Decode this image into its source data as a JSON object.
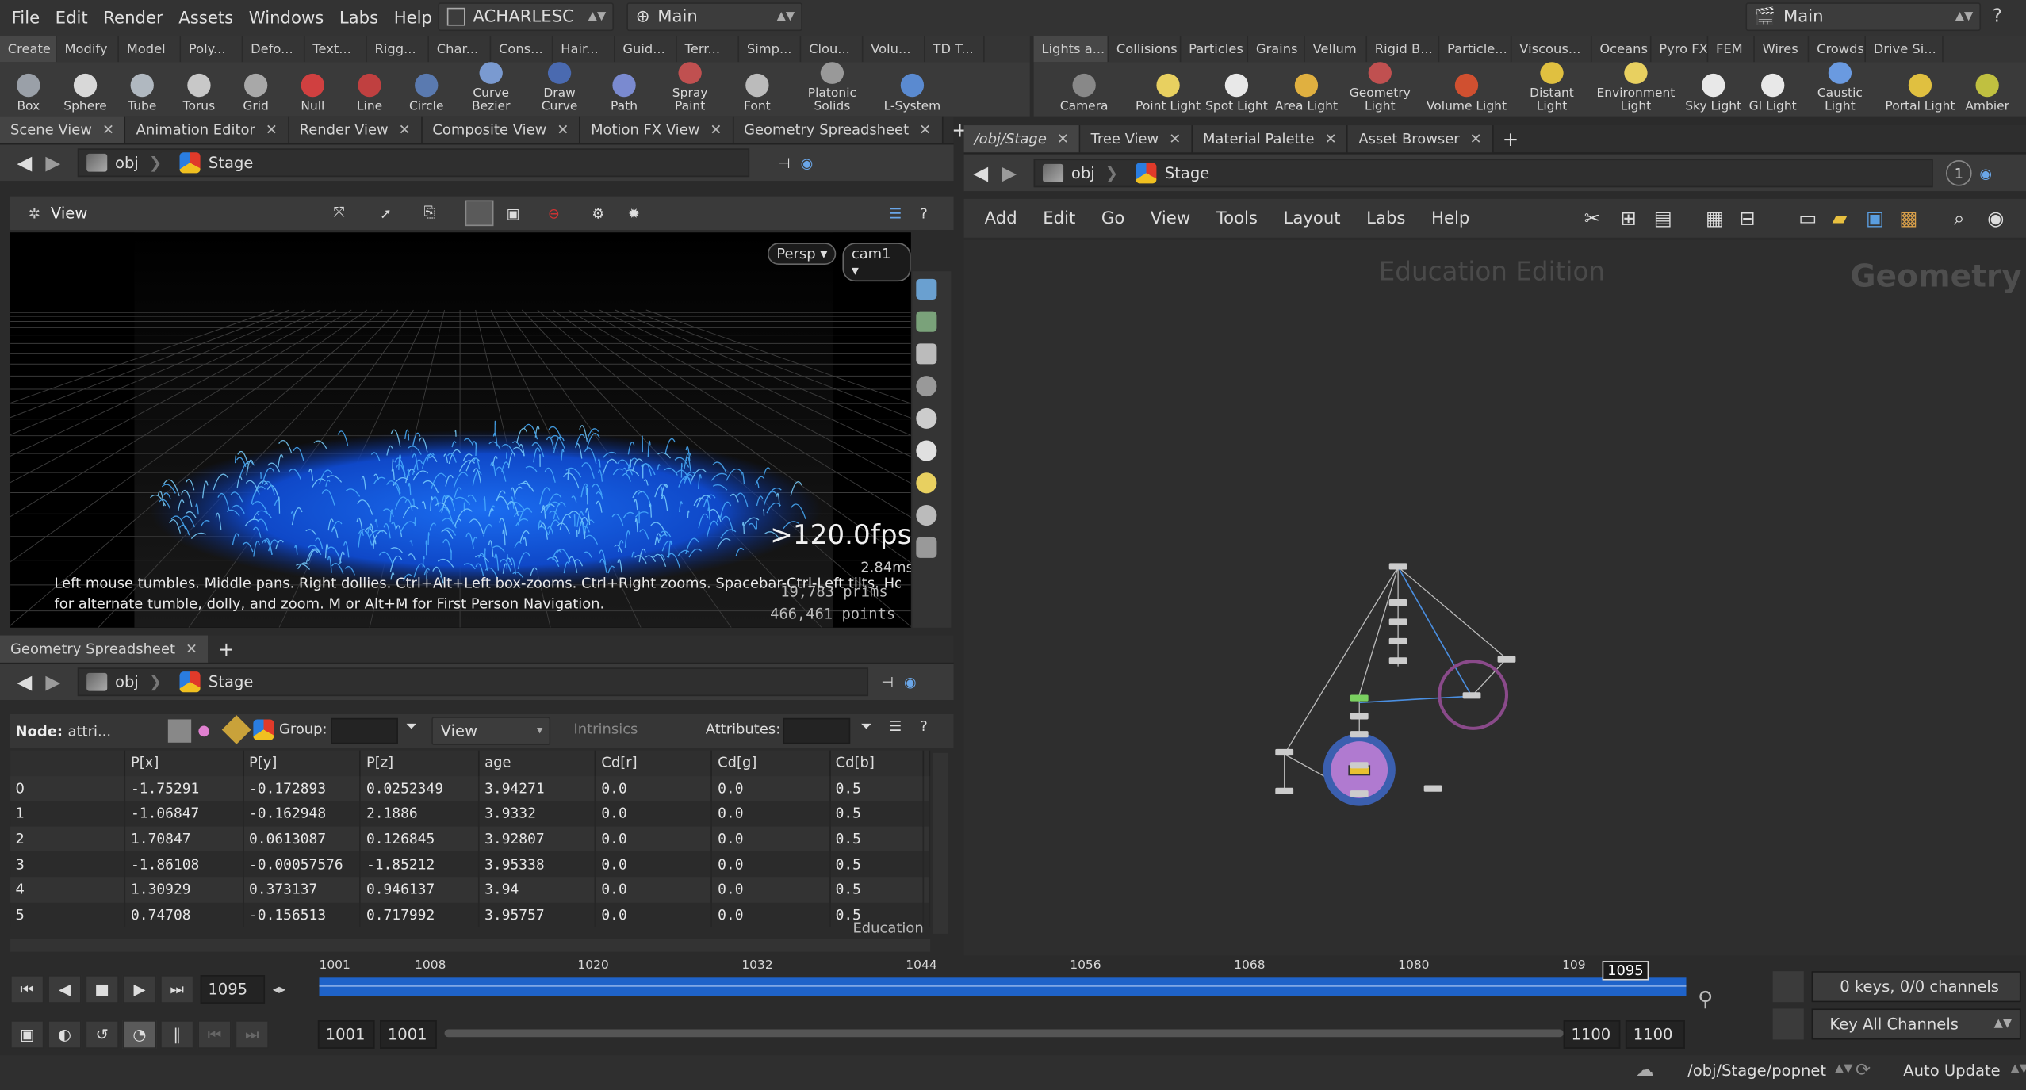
{
  "menu": {
    "items": [
      "File",
      "Edit",
      "Render",
      "Assets",
      "Windows",
      "Labs",
      "Help"
    ],
    "desktop": "ACHARLESC",
    "context": "Main",
    "right_desktop": "Main"
  },
  "shelf_left": {
    "tabs": [
      "Create",
      "Modify",
      "Model",
      "Poly...",
      "Defo...",
      "Text...",
      "Rigg...",
      "Char...",
      "Cons...",
      "Hair...",
      "Guid...",
      "Terr...",
      "Simp...",
      "Clou...",
      "Volu...",
      "TD T..."
    ],
    "tools": [
      "Box",
      "Sphere",
      "Tube",
      "Torus",
      "Grid",
      "Null",
      "Line",
      "Circle",
      "Curve Bezier",
      "Draw Curve",
      "Path",
      "Spray Paint",
      "Font",
      "Platonic Solids",
      "L-System"
    ]
  },
  "shelf_right": {
    "tabs": [
      "Lights a...",
      "Collisions",
      "Particles",
      "Grains",
      "Vellum",
      "Rigid B...",
      "Particle...",
      "Viscous...",
      "Oceans",
      "Pyro FX",
      "FEM",
      "Wires",
      "Crowds",
      "Drive Si..."
    ],
    "tools": [
      "Camera",
      "Point Light",
      "Spot Light",
      "Area Light",
      "Geometry Light",
      "Volume Light",
      "Distant Light",
      "Environment Light",
      "Sky Light",
      "GI Light",
      "Caustic Light",
      "Portal Light",
      "Ambier"
    ]
  },
  "left_pane": {
    "tabs": [
      "Scene View",
      "Animation Editor",
      "Render View",
      "Composite View",
      "Motion FX View",
      "Geometry Spreadsheet"
    ],
    "path": {
      "root": "obj",
      "node": "Stage"
    },
    "view_label": "View",
    "persp": "Persp",
    "camera": "cam1",
    "fps": ">120.0fps",
    "ms": "2.84ms",
    "prims": "19,783  prims",
    "points": "466,461 points",
    "hint_line1": "Left mouse tumbles. Middle pans. Right dollies. Ctrl+Alt+Left box-zooms. Ctrl+Right zooms. Spacebar-Ctrl-Left tilts. Hold L",
    "hint_line2": "for alternate tumble, dolly, and zoom.    M or Alt+M for First Person Navigation."
  },
  "spreadsheet": {
    "tab": "Geometry Spreadsheet",
    "path": {
      "root": "obj",
      "node": "Stage"
    },
    "node_label": "Node:",
    "node_value": "attri...",
    "group_label": "Group:",
    "view_label": "View",
    "intrinsics_label": "Intrinsics",
    "attributes_label": "Attributes:",
    "columns": [
      "P[x]",
      "P[y]",
      "P[z]",
      "age",
      "Cd[r]",
      "Cd[g]",
      "Cd[b]"
    ],
    "rows": [
      {
        "i": "0",
        "c": [
          "-1.75291",
          "-0.172893",
          "0.0252349",
          "3.94271",
          "0.0",
          "0.0",
          "0.5"
        ]
      },
      {
        "i": "1",
        "c": [
          "-1.06847",
          "-0.162948",
          "2.1886",
          "3.9332",
          "0.0",
          "0.0",
          "0.5"
        ]
      },
      {
        "i": "2",
        "c": [
          "1.70847",
          "0.0613087",
          "0.126845",
          "3.92807",
          "0.0",
          "0.0",
          "0.5"
        ]
      },
      {
        "i": "3",
        "c": [
          "-1.86108",
          "-0.00057576",
          "-1.85212",
          "3.95338",
          "0.0",
          "0.0",
          "0.5"
        ]
      },
      {
        "i": "4",
        "c": [
          "1.30929",
          "0.373137",
          "0.946137",
          "3.94",
          "0.0",
          "0.0",
          "0.5"
        ]
      },
      {
        "i": "5",
        "c": [
          "0.74708",
          "-0.156513",
          "0.717992",
          "3.95757",
          "0.0",
          "0.0",
          "0.5"
        ]
      }
    ],
    "watermark": "Education"
  },
  "right_pane": {
    "tabs": [
      "/obj/Stage",
      "Tree View",
      "Material Palette",
      "Asset Browser"
    ],
    "path": {
      "root": "obj",
      "node": "Stage"
    },
    "counter": "1",
    "menu": [
      "Add",
      "Edit",
      "Go",
      "View",
      "Tools",
      "Layout",
      "Labs",
      "Help"
    ],
    "edition": "Education Edition",
    "context_label": "Geometry"
  },
  "timeline": {
    "current_frame": "1095",
    "ticks": [
      "1001",
      "1008",
      "1020",
      "1032",
      "1044",
      "1056",
      "1068",
      "1080",
      "109"
    ],
    "marker": "1095",
    "start": "1001",
    "start2": "1001",
    "end": "1100",
    "end2": "1100",
    "keys_status": "0 keys, 0/0 channels",
    "key_all": "Key All Channels"
  },
  "statusbar": {
    "path": "/obj/Stage/popnet",
    "update_mode": "Auto Update"
  },
  "colors": {
    "accent": "#3a8ee8",
    "timeline_blue": "#1f63c9",
    "hair_blue": "#1a6cf0"
  }
}
